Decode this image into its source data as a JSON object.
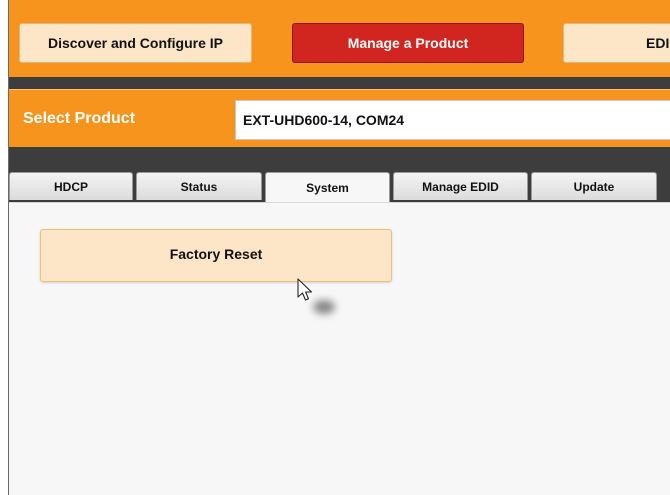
{
  "nav": {
    "discover_label": "Discover and Configure IP",
    "manage_label": "Manage a Product",
    "edid_label": "EDI"
  },
  "product": {
    "label": "Select Product",
    "value": "EXT-UHD600-14, COM24"
  },
  "tabs": [
    {
      "label": "HDCP"
    },
    {
      "label": "Status"
    },
    {
      "label": "System",
      "selected": true
    },
    {
      "label": "Manage EDID"
    },
    {
      "label": "Update"
    }
  ],
  "system": {
    "factory_reset_label": "Factory Reset"
  },
  "icons": {
    "cursor": "pointer-cursor-icon"
  },
  "colors": {
    "accent_orange": "#f7941d",
    "active_red": "#d0261f",
    "button_light": "#fde6c8",
    "dark_band": "#3d3d3d"
  }
}
